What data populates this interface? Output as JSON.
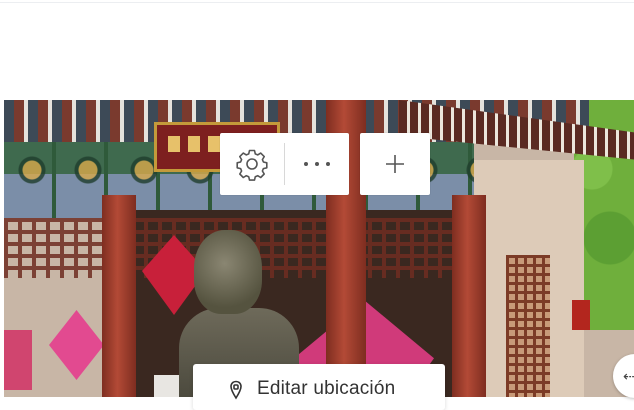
{
  "toolbar": {
    "settings_icon": "gear-icon",
    "more_icon": "ellipsis-icon",
    "add_icon": "plus-icon"
  },
  "edit_location": {
    "label": "Editar ubicación",
    "icon": "pin-icon"
  },
  "edge_button": {
    "icon": "arrow-left-icon",
    "glyph": "⇠"
  },
  "colors": {
    "toolbar_bg": "#ffffff",
    "icon_stroke": "#555555",
    "text": "#333333"
  }
}
